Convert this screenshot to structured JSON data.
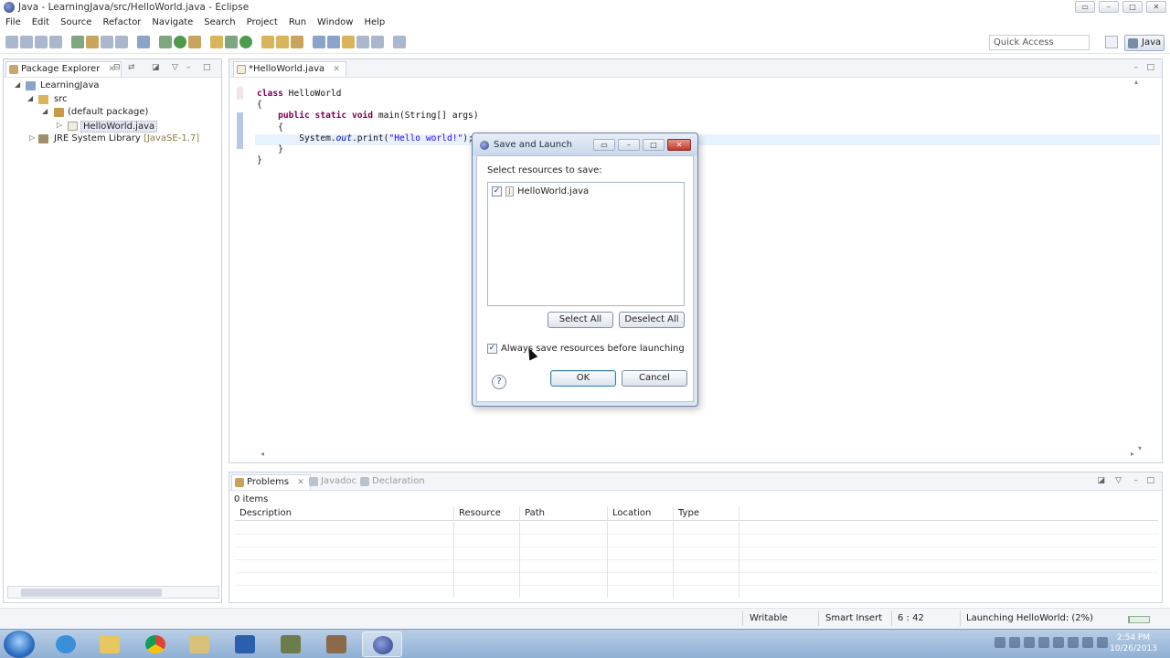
{
  "window": {
    "title": "Java - LearningJava/src/HelloWorld.java - Eclipse"
  },
  "menu": [
    "File",
    "Edit",
    "Source",
    "Refactor",
    "Navigate",
    "Search",
    "Project",
    "Run",
    "Window",
    "Help"
  ],
  "toolbar": {
    "quick_access_placeholder": "Quick Access",
    "perspective_label": "Java"
  },
  "package_explorer": {
    "tab_label": "Package Explorer",
    "tree": {
      "project": "LearningJava",
      "src": "src",
      "default_package": "(default package)",
      "file": "HelloWorld.java",
      "jre_label": "JRE System Library",
      "jre_version": "[JavaSE-1.7]"
    }
  },
  "editor": {
    "tab_label": "*HelloWorld.java",
    "code": {
      "line1_kw": "class",
      "line1_name": " HelloWorld",
      "line2": "{",
      "line3_kw": "public static void",
      "line3_rest": " main(String[] args)",
      "line4": "{",
      "line5_a": "System.",
      "line5_b": "out",
      "line5_c": ".print(",
      "line5_str": "\"Hello world!\"",
      "line5_d": ");",
      "line6": "}",
      "line7": "}"
    }
  },
  "problems_view": {
    "tabs": [
      "Problems",
      "Javadoc",
      "Declaration"
    ],
    "item_count": "0 items",
    "columns": [
      "Description",
      "Resource",
      "Path",
      "Location",
      "Type"
    ]
  },
  "status_bar": {
    "writable": "Writable",
    "insert_mode": "Smart Insert",
    "position": "6 : 42",
    "progress": "Launching HelloWorld: (2%)",
    "progress_fraction": 0.02
  },
  "taskbar": {
    "time": "2:54 PM",
    "date": "10/26/2013"
  },
  "dialog": {
    "title": "Save and Launch",
    "prompt": "Select resources to save:",
    "resource_item": "HelloWorld.java",
    "resource_checked": true,
    "select_all": "Select All",
    "deselect_all": "Deselect All",
    "always_save_label": "Always save resources before launching",
    "always_save_checked": true,
    "ok": "OK",
    "cancel": "Cancel"
  }
}
